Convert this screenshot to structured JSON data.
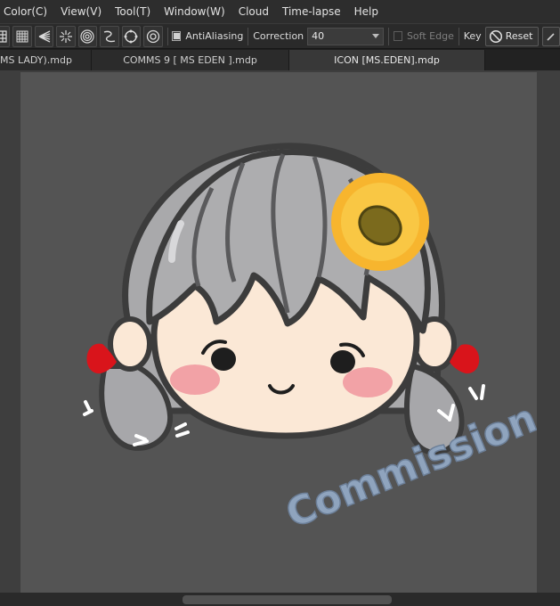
{
  "menu": {
    "items": [
      "Color(C)",
      "View(V)",
      "Tool(T)",
      "Window(W)",
      "Cloud",
      "Time-lapse",
      "Help"
    ]
  },
  "toolbar": {
    "tool_icons": [
      "grid-icon",
      "dense-grid-icon",
      "perspective-icon",
      "radial-lines-icon",
      "concentric-circles-icon",
      "curve-snap-icon",
      "circle-snap-icon",
      "ellipse-snap-icon"
    ],
    "antialiasing_label": "AntiAliasing",
    "antialiasing_checked": true,
    "correction_label": "Correction",
    "correction_value": "40",
    "soft_edge_label": "Soft Edge",
    "soft_edge_checked": false,
    "key_label": "Key",
    "reset_label": "Reset"
  },
  "tabs": [
    {
      "label": "MS LADY).mdp"
    },
    {
      "label": "COMMS 9 [ MS EDEN ].mdp"
    },
    {
      "label": "ICON [MS.EDEN].mdp",
      "active": true
    }
  ],
  "canvas": {
    "artwork": "chibi-girl-icon",
    "watermark_text": "Commission",
    "background_color": "#545454",
    "hair_color": "#a9a9ab",
    "skin_color": "#fbe8d6",
    "blush_color": "#f2a2a6",
    "bow_color": "#d9141b",
    "sunflower_color": "#f7b52e",
    "watermark_color": "#8fa4be"
  }
}
